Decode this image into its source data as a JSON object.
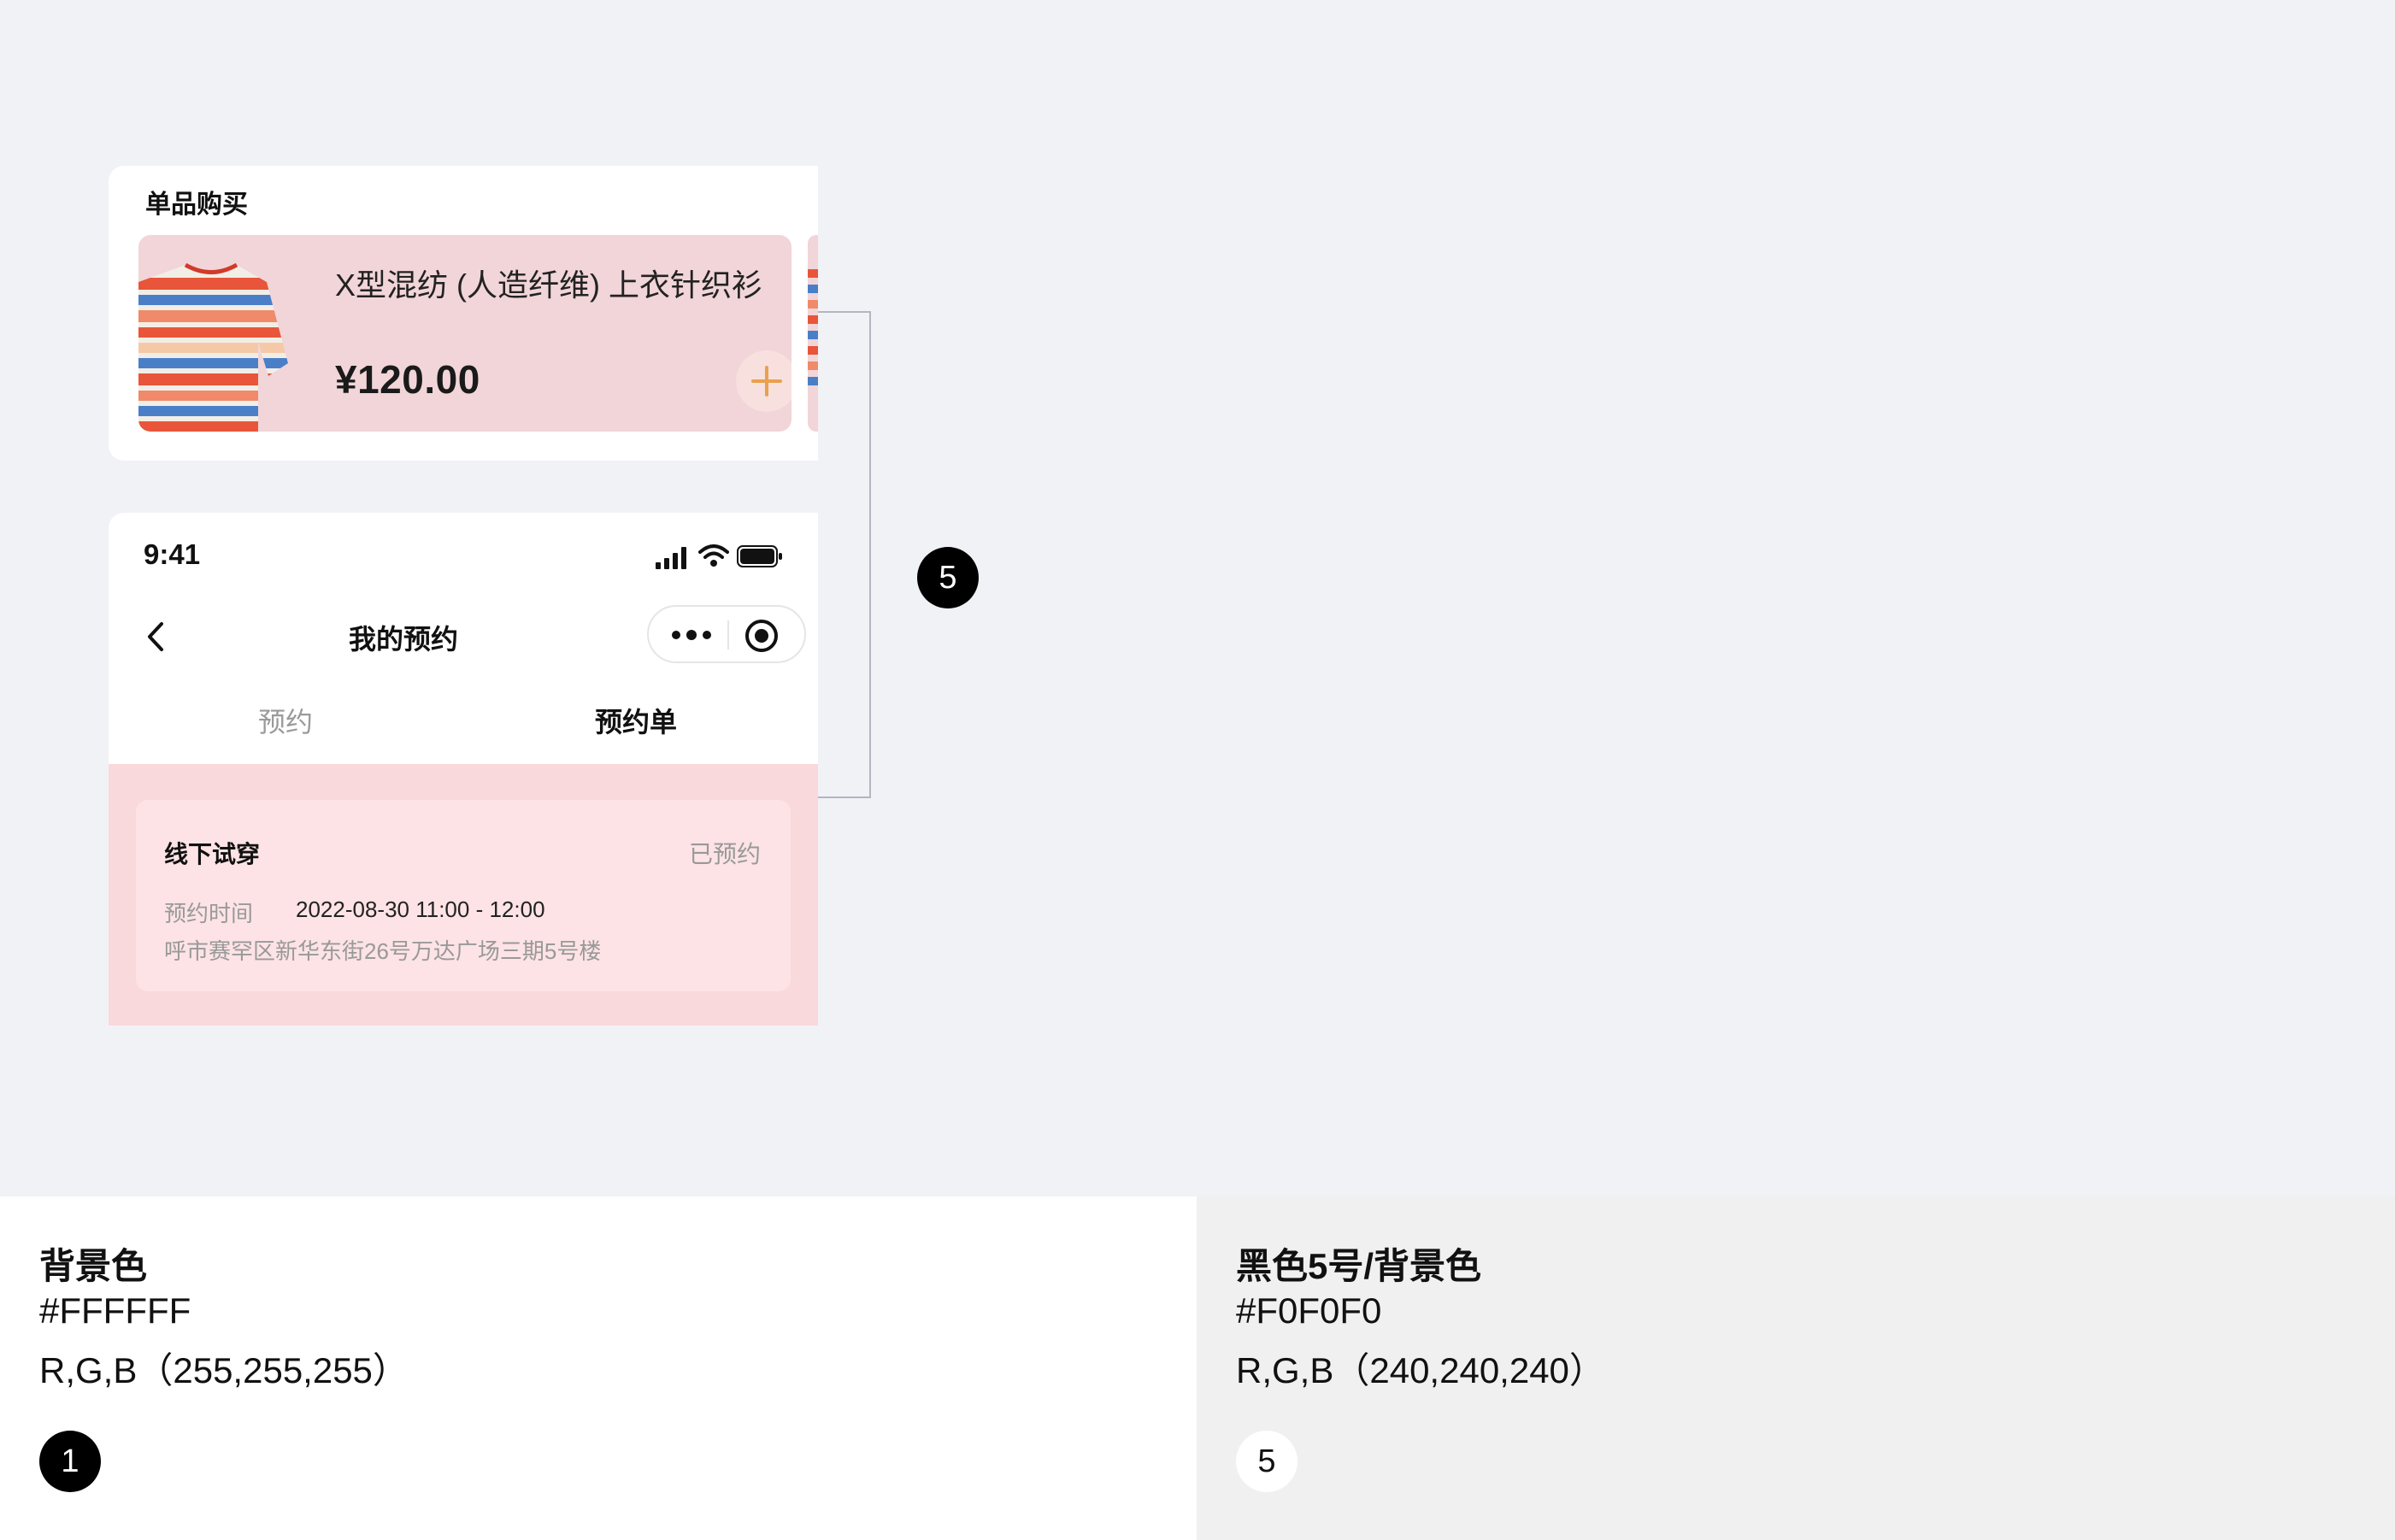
{
  "product_section": {
    "title": "单品购买",
    "product": {
      "name": "X型混纺 (人造纤维) 上衣针织衫",
      "price": "¥120.00",
      "add_icon": "plus-icon"
    }
  },
  "annotation": {
    "badge": "5"
  },
  "phone": {
    "status_bar": {
      "time": "9:41",
      "icons": [
        "signal-icon",
        "wifi-icon",
        "battery-icon"
      ]
    },
    "nav": {
      "title": "我的预约",
      "back_icon": "chevron-left-icon",
      "more_icon": "more-dots-icon",
      "target_icon": "target-icon"
    },
    "tabs": [
      {
        "label": "预约",
        "active": false
      },
      {
        "label": "预约单",
        "active": true
      }
    ],
    "order": {
      "title": "线下试穿",
      "status": "已预约",
      "time_label": "预约时间",
      "time_value": "2022-08-30 11:00 - 12:00",
      "address": "呼市赛罕区新华东街26号万达广场三期5号楼"
    }
  },
  "swatches": [
    {
      "name": "背景色",
      "hex": "#FFFFFF",
      "rgb": "R,G,B（255,255,255）",
      "badge": "1"
    },
    {
      "name": "黑色5号/背景色",
      "hex": "#F0F0F0",
      "rgb": "R,G,B（240,240,240）",
      "badge": "5"
    }
  ],
  "colors": {
    "page_bg": "#F1F2F6",
    "product_bg": "#F1D5D8",
    "list_bg": "#F9D9DB",
    "order_card_bg": "#FDE3E5",
    "accent_orange": "#E9A14E"
  }
}
